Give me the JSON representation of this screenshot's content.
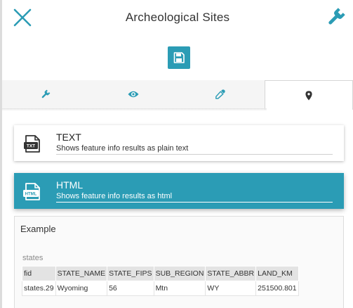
{
  "header": {
    "title": "Archeological Sites",
    "close_icon": "close-icon",
    "settings_icon": "wrench-icon",
    "accent_color": "#2b9cb5"
  },
  "toolbar": {
    "save_icon": "save-icon"
  },
  "tabs": [
    {
      "icon": "wrench-icon",
      "active": false
    },
    {
      "icon": "eye-icon",
      "active": false
    },
    {
      "icon": "eyedropper-icon",
      "active": false
    },
    {
      "icon": "map-marker-icon",
      "active": true
    }
  ],
  "format_options": [
    {
      "name": "TEXT",
      "description": "Shows feature info results as plain text",
      "icon": "txt-file-icon",
      "selected": false
    },
    {
      "name": "HTML",
      "description": "Shows feature info results as html",
      "icon": "html-file-icon",
      "selected": true
    }
  ],
  "example": {
    "title": "Example",
    "layer": "states",
    "columns": [
      "fid",
      "STATE_NAME",
      "STATE_FIPS",
      "SUB_REGION",
      "STATE_ABBR",
      "LAND_KM"
    ],
    "rows": [
      [
        "states.29",
        "Wyoming",
        "56",
        "Mtn",
        "WY",
        "251500.801"
      ]
    ]
  }
}
